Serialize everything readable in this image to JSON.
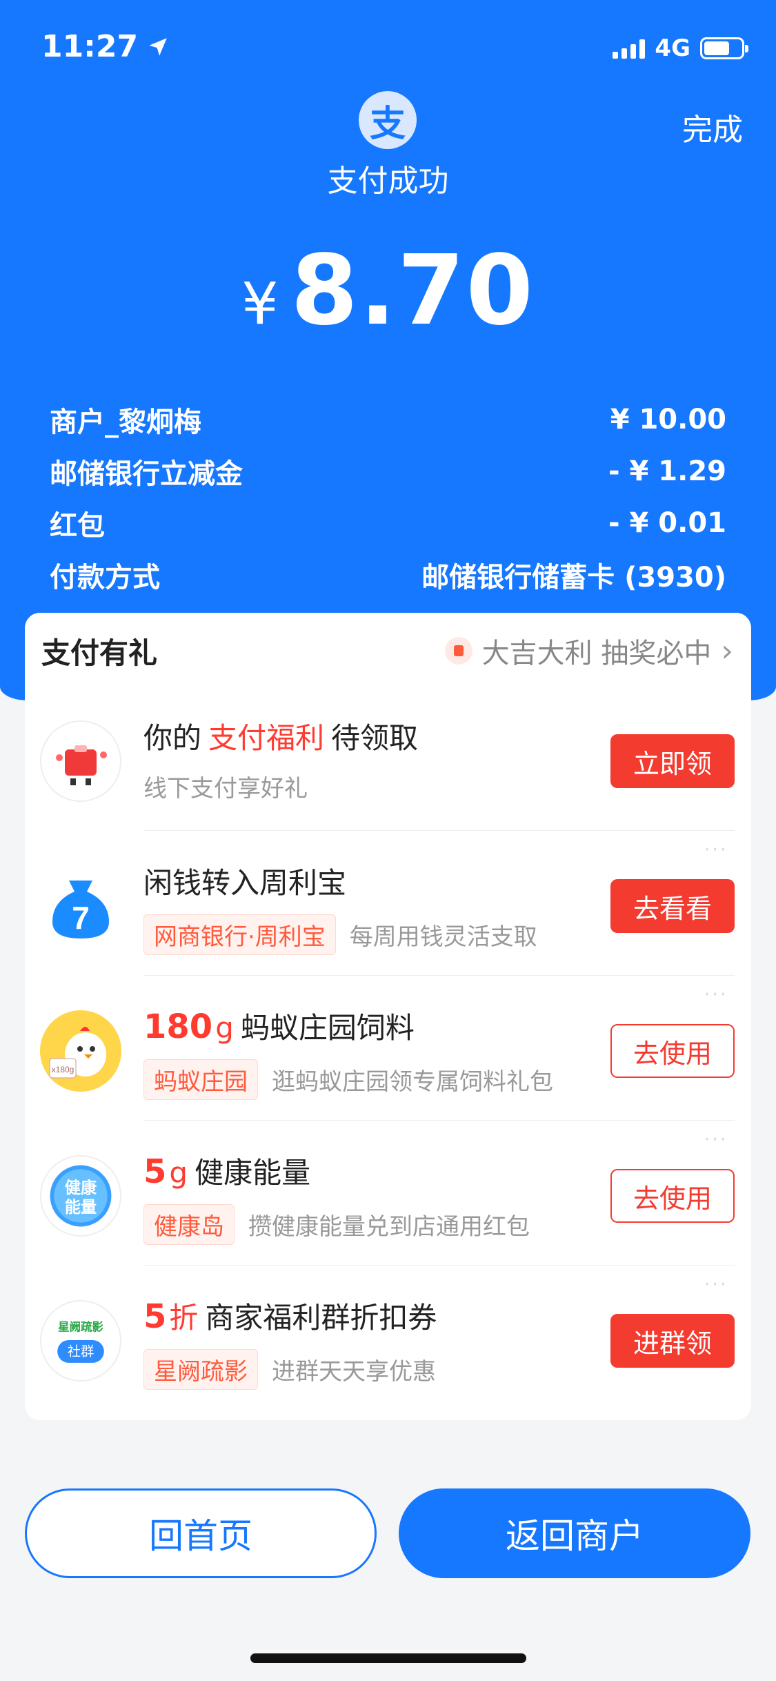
{
  "status_bar": {
    "time": "11:27",
    "network": "4G"
  },
  "header": {
    "title": "支付成功",
    "done": "完成"
  },
  "amount": {
    "currency": "¥",
    "value": "8.70"
  },
  "details": [
    {
      "label": "商户_黎炯梅",
      "value": "¥ 10.00"
    },
    {
      "label": "邮储银行立减金",
      "value": "- ¥ 1.29"
    },
    {
      "label": "红包",
      "value": "- ¥ 0.01"
    },
    {
      "label": "付款方式",
      "value": "邮储银行储蓄卡 (3930)"
    }
  ],
  "card": {
    "title": "支付有礼",
    "promo": "大吉大利 抽奖必中",
    "items": [
      {
        "t1a": "你的",
        "t1b": "支付福利",
        "t1c": "待领取",
        "sub": "线下支付享好礼",
        "button": "立即领"
      },
      {
        "title": "闲钱转入周利宝",
        "tag": "网商银行·周利宝",
        "sub": "每周用钱灵活支取",
        "button": "去看看",
        "icon_text": "7"
      },
      {
        "amount": "180",
        "unit": "g",
        "title": "蚂蚁庄园饲料",
        "tag": "蚂蚁庄园",
        "sub": "逛蚂蚁庄园领专属饲料礼包",
        "button": "去使用",
        "icon_text": "x180g"
      },
      {
        "amount": "5",
        "unit": "g",
        "title": "健康能量",
        "tag": "健康岛",
        "sub": "攒健康能量兑到店通用红包",
        "button": "去使用",
        "icon_line1": "健康",
        "icon_line2": "能量"
      },
      {
        "amount": "5",
        "unit": "折",
        "title": "商家福利群折扣券",
        "tag": "星阙疏影",
        "sub": "进群天天享优惠",
        "button": "进群领",
        "icon_line1": "星阙疏影",
        "icon_line2": "社群"
      }
    ]
  },
  "buttons": {
    "home": "回首页",
    "merchant": "返回商户"
  },
  "colors": {
    "brand": "#1677ff",
    "accent_red": "#f43b30"
  }
}
